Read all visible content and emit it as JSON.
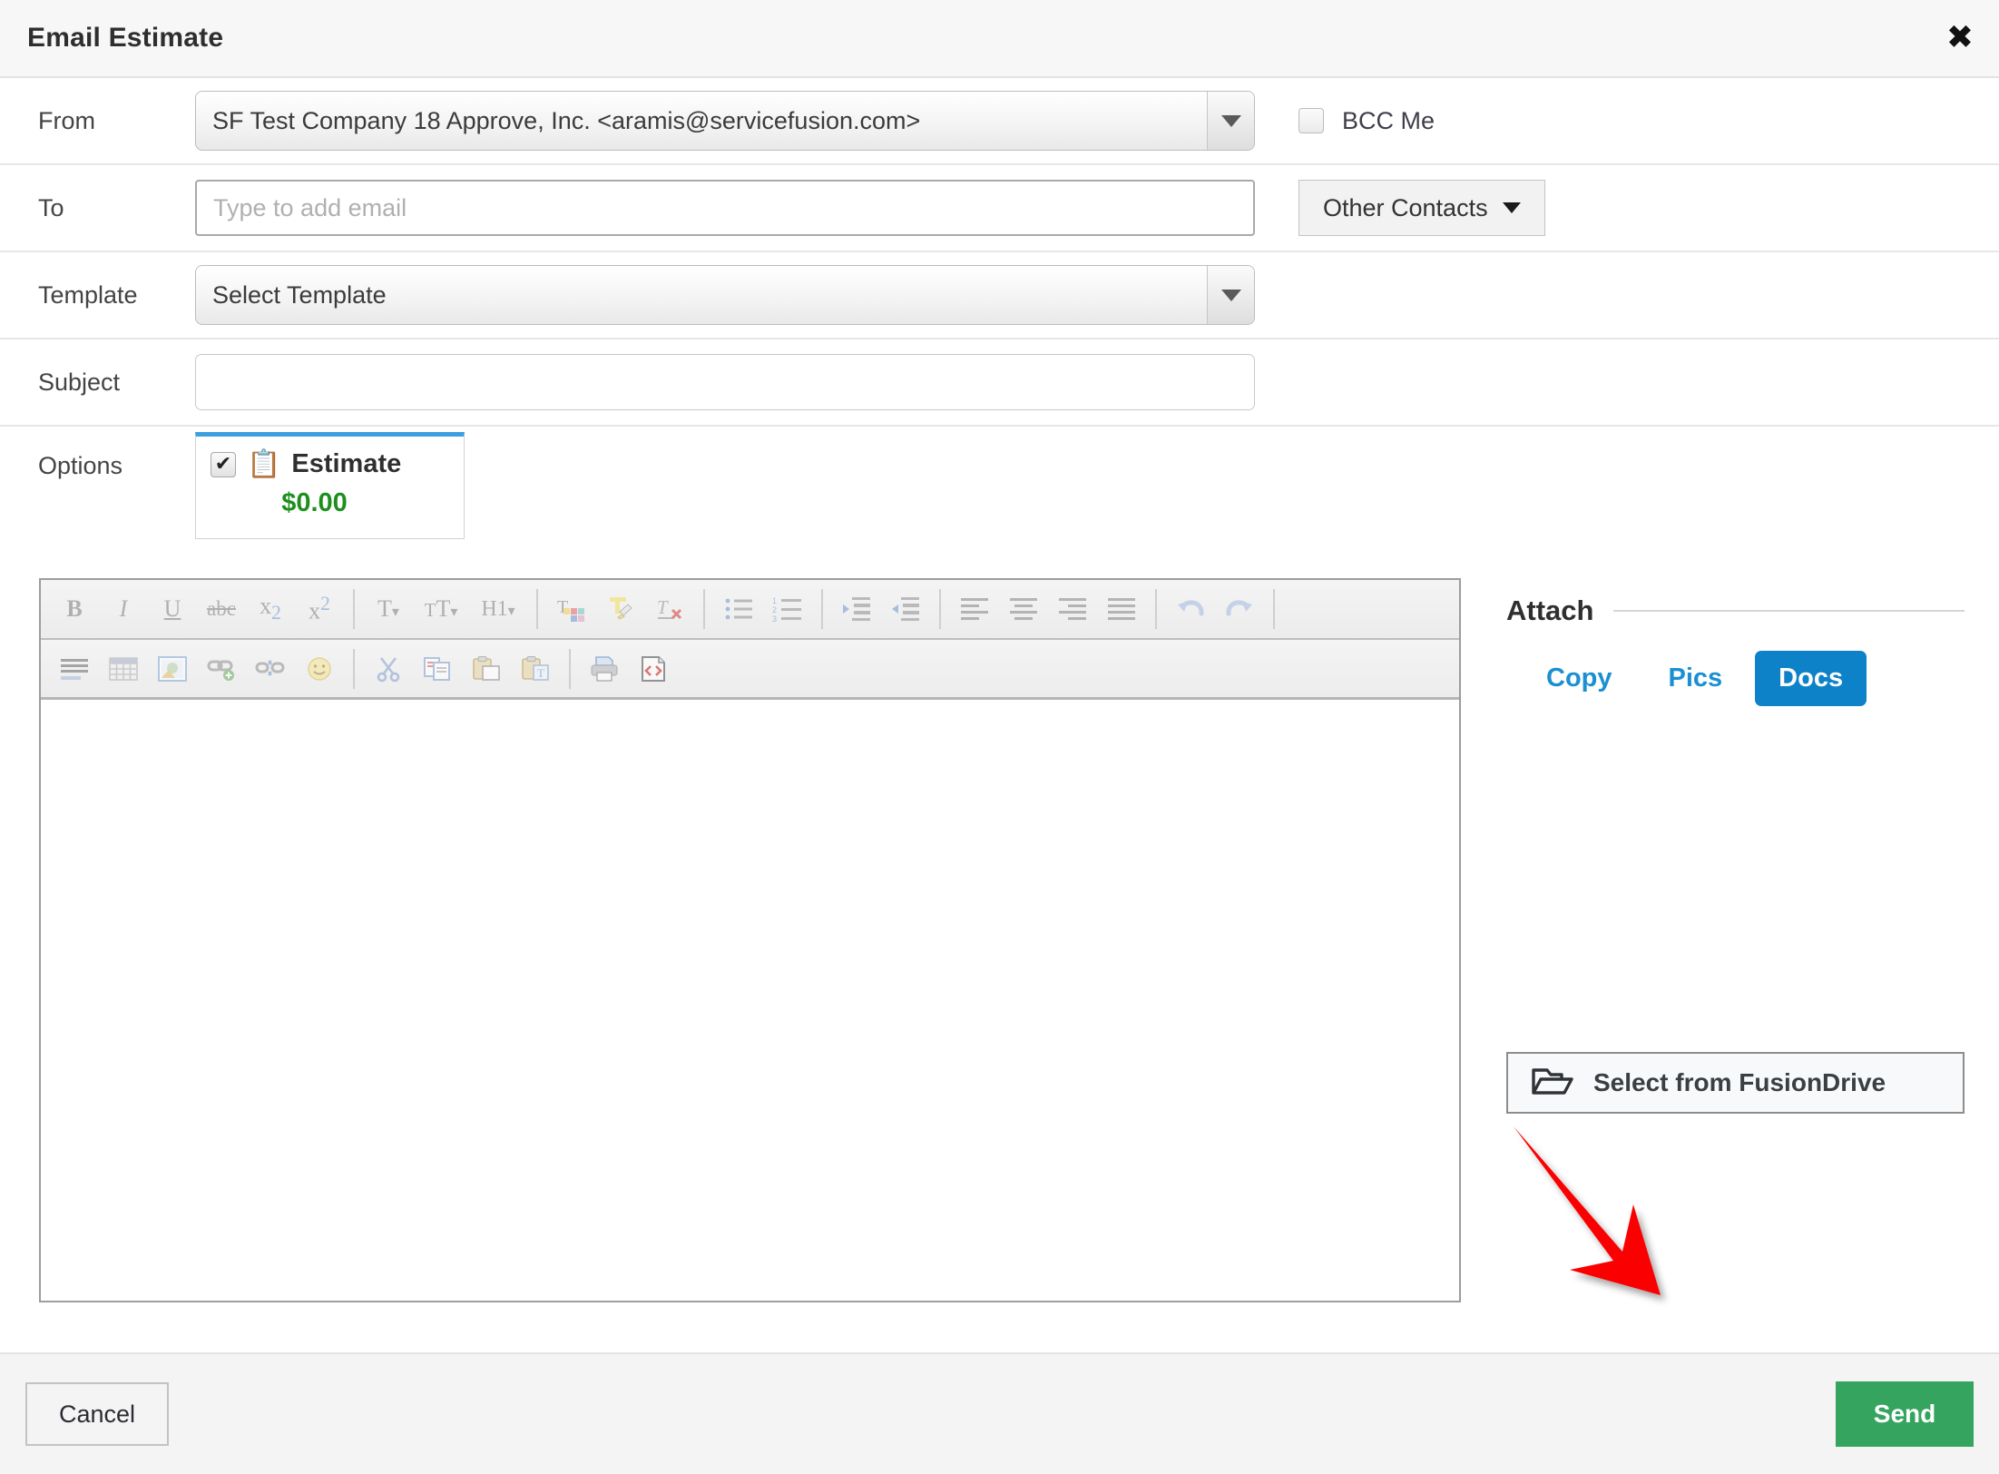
{
  "header": {
    "title": "Email Estimate",
    "close_label": "✖"
  },
  "form": {
    "from": {
      "label": "From",
      "value": "SF Test Company 18 Approve, Inc. <aramis@servicefusion.com>"
    },
    "bcc": {
      "label": "BCC Me",
      "checked": false
    },
    "to": {
      "label": "To",
      "placeholder": "Type to add email",
      "value": ""
    },
    "other_contacts": {
      "label": "Other Contacts"
    },
    "template": {
      "label": "Template",
      "value": "Select Template"
    },
    "subject": {
      "label": "Subject",
      "placeholder": "",
      "value": ""
    },
    "options": {
      "label": "Options",
      "item": {
        "name": "Estimate",
        "amount": "$0.00",
        "checked": true,
        "check_glyph": "✔",
        "icon": "clipboard-icon",
        "icon_glyph": "📋",
        "accent_color": "#3c9fe0"
      }
    }
  },
  "editor": {
    "toolbar_row1": [
      {
        "name": "bold-icon",
        "glyph": "B"
      },
      {
        "name": "italic-icon",
        "glyph": "I"
      },
      {
        "name": "underline-icon",
        "glyph": "U"
      },
      {
        "name": "strikethrough-icon",
        "glyph": "abc"
      },
      {
        "name": "subscript-icon",
        "glyph": "x₂"
      },
      {
        "name": "superscript-icon",
        "glyph": "x²"
      },
      {
        "name": "separator",
        "glyph": ""
      },
      {
        "name": "font-family-icon",
        "glyph": "T▾"
      },
      {
        "name": "font-size-icon",
        "glyph": "тT▾"
      },
      {
        "name": "heading-format-icon",
        "glyph": "H1▾"
      },
      {
        "name": "separator",
        "glyph": ""
      },
      {
        "name": "text-color-icon",
        "glyph": "T"
      },
      {
        "name": "highlight-color-icon",
        "glyph": "T"
      },
      {
        "name": "remove-format-icon",
        "glyph": "T"
      },
      {
        "name": "separator",
        "glyph": ""
      },
      {
        "name": "bullet-list-icon",
        "glyph": ""
      },
      {
        "name": "numbered-list-icon",
        "glyph": ""
      },
      {
        "name": "separator",
        "glyph": ""
      },
      {
        "name": "outdent-icon",
        "glyph": ""
      },
      {
        "name": "indent-icon",
        "glyph": ""
      },
      {
        "name": "separator",
        "glyph": ""
      },
      {
        "name": "align-left-icon",
        "glyph": ""
      },
      {
        "name": "align-center-icon",
        "glyph": ""
      },
      {
        "name": "align-right-icon",
        "glyph": ""
      },
      {
        "name": "align-justify-icon",
        "glyph": ""
      },
      {
        "name": "separator",
        "glyph": ""
      },
      {
        "name": "undo-icon",
        "glyph": "↶"
      },
      {
        "name": "redo-icon",
        "glyph": "↷"
      }
    ],
    "toolbar_row2": [
      {
        "name": "horizontal-rule-icon",
        "glyph": ""
      },
      {
        "name": "table-icon",
        "glyph": ""
      },
      {
        "name": "image-icon",
        "glyph": ""
      },
      {
        "name": "link-icon",
        "glyph": ""
      },
      {
        "name": "unlink-icon",
        "glyph": ""
      },
      {
        "name": "emoji-icon",
        "glyph": ""
      },
      {
        "name": "separator",
        "glyph": ""
      },
      {
        "name": "cut-icon",
        "glyph": "✂"
      },
      {
        "name": "copy-icon",
        "glyph": ""
      },
      {
        "name": "paste-icon",
        "glyph": ""
      },
      {
        "name": "paste-as-text-icon",
        "glyph": "T"
      },
      {
        "name": "separator",
        "glyph": ""
      },
      {
        "name": "print-icon",
        "glyph": ""
      },
      {
        "name": "source-code-icon",
        "glyph": "<>"
      }
    ],
    "body_value": ""
  },
  "attach": {
    "title": "Attach",
    "tabs": [
      {
        "label": "Copy",
        "active": false
      },
      {
        "label": "Pics",
        "active": false
      },
      {
        "label": "Docs",
        "active": true
      }
    ],
    "fusion_drive_button": {
      "label": "Select from FusionDrive",
      "icon": "open-folder-icon"
    },
    "active_color": "#0e82c8",
    "link_color": "#1a8fd1"
  },
  "annotation": {
    "arrow_color": "#fb0000",
    "points_to": "Select from FusionDrive"
  },
  "footer": {
    "cancel_label": "Cancel",
    "send_label": "Send",
    "send_color": "#35a45f"
  }
}
